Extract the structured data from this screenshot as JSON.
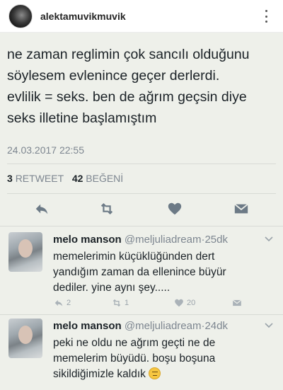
{
  "post": {
    "username": "alektamuvikmuvik",
    "avatar_icon": "profile-avatar",
    "more_icon": "vertical-dots-icon"
  },
  "tweet": {
    "text": "ne zaman reglimin çok sancılı olduğunu\nsöylesem evlenince geçer derlerdi.\nevlilik = seks. ben de ağrım geçsin diye\nseks illetine başlamıştım",
    "timestamp": "24.03.2017 22:55",
    "retweet_count": "3",
    "retweet_label": "RETWEET",
    "like_count": "42",
    "like_label": "BEĞENİ",
    "icons": [
      "reply-icon",
      "retweet-icon",
      "heart-icon",
      "direct-message-icon"
    ],
    "accent_color": "#657786"
  },
  "replies": [
    {
      "name": "melo manson",
      "handle": "@meljuliadream",
      "separator": "·",
      "time": "25dk",
      "text": "memelerimin küçüklüğünden dert\nyandığım zaman da ellenince büyür\ndediler. yine aynı şey.....",
      "reply_count": "2",
      "retweet_count": "1",
      "like_count": "20"
    },
    {
      "name": "melo manson",
      "handle": "@meljuliadream",
      "separator": "·",
      "time": "24dk",
      "text": "peki ne oldu ne ağrım geçti ne de\nmemelerim büyüdü. boşu boşuna\nsikildiğimizle kaldık",
      "emoji": "unamused-face"
    }
  ]
}
